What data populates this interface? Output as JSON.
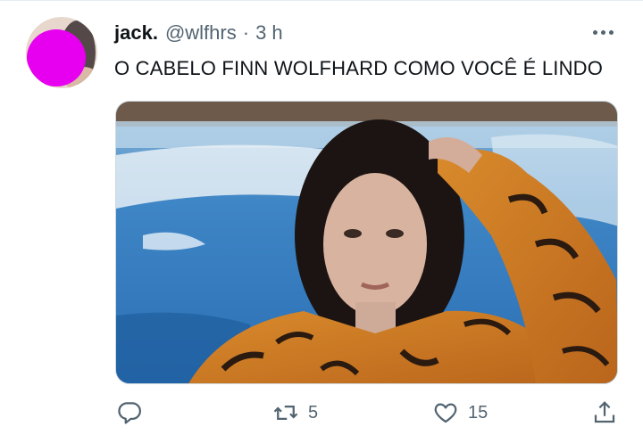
{
  "tweet": {
    "display_name": "jack.",
    "handle": "@wlfhrs",
    "separator": "·",
    "time": "3 h",
    "text": "O CABELO FINN WOLFHARD COMO VOCÊ É LINDO"
  },
  "media": {
    "alt": "Photo"
  },
  "actions": {
    "reply_icon": "reply-icon",
    "retweet_icon": "retweet-icon",
    "retweet_count": "5",
    "like_icon": "heart-icon",
    "like_count": "15",
    "share_icon": "share-icon"
  },
  "colors": {
    "text": "#0f1419",
    "secondary": "#536471",
    "avatar_redaction": "#e600ef",
    "divider": "#e6ecf0"
  }
}
